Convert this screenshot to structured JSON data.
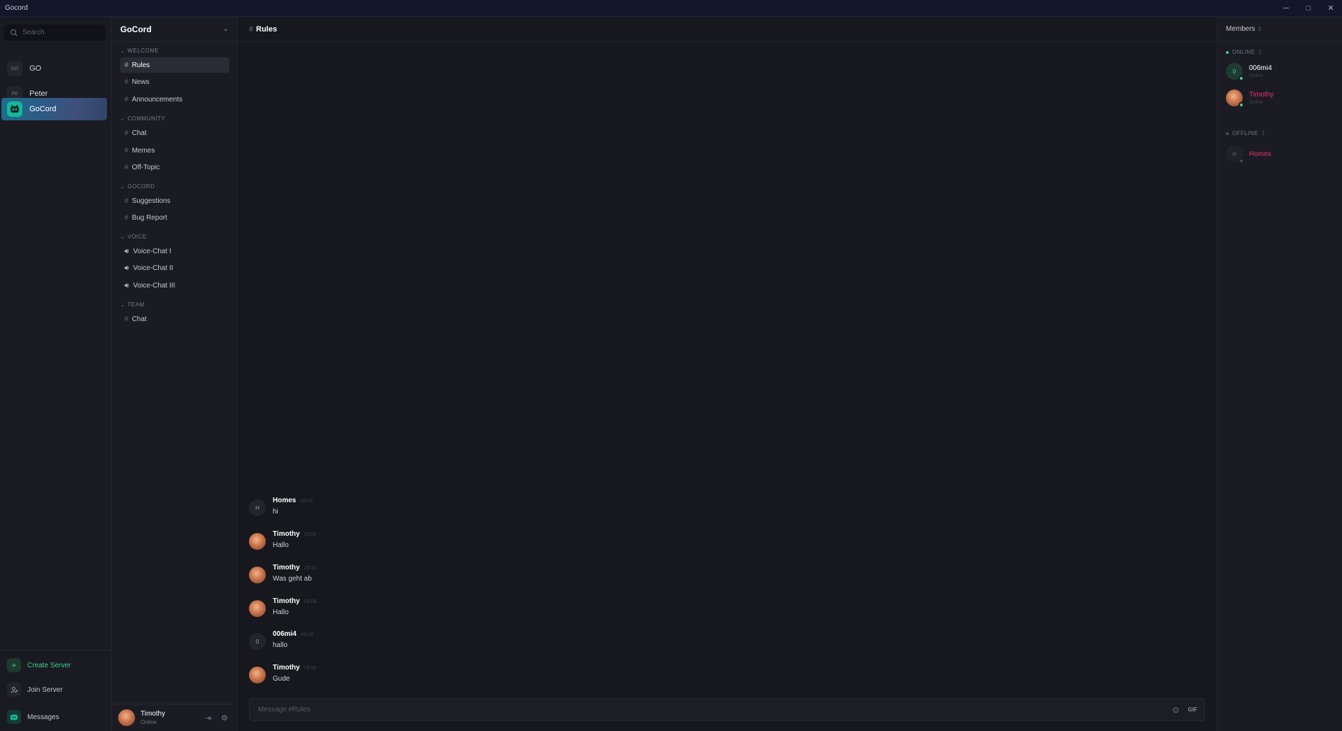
{
  "window": {
    "title": "Gocord",
    "min": "─",
    "max": "□",
    "close": "✕"
  },
  "search": {
    "placeholder": "Search"
  },
  "servers": [
    {
      "abbr": "GO",
      "name": "GO"
    },
    {
      "abbr": "PE",
      "name": "Peter"
    },
    {
      "abbr": "",
      "name": "GoCord"
    }
  ],
  "footer": {
    "create": "Create Server",
    "join": "Join Server",
    "messages": "Messages"
  },
  "server_header": {
    "title": "GoCord"
  },
  "categories": [
    {
      "name": "WELCOME",
      "channels": [
        "Rules",
        "News",
        "Announcements"
      ]
    },
    {
      "name": "COMMUNITY",
      "channels": [
        "Chat",
        "Memes",
        "Off-Topic"
      ]
    },
    {
      "name": "GOCORD",
      "channels": [
        "Suggestions",
        "Bug Report"
      ]
    },
    {
      "name": "VOICE",
      "channels": [
        "Voice-Chat I",
        "Voice-Chat II",
        "Voice-Chat III"
      ]
    },
    {
      "name": "TEAM",
      "channels": [
        "Chat"
      ]
    }
  ],
  "active_channel": "Rules",
  "user": {
    "name": "Timothy",
    "status": "Online"
  },
  "messages": [
    {
      "avatar": "H",
      "author": "Homes",
      "time": "20:03",
      "text": "hi"
    },
    {
      "avatar": "",
      "author": "Timothy",
      "time": "20:04",
      "text": "Hallo"
    },
    {
      "avatar": "",
      "author": "Timothy",
      "time": "23:15",
      "text": "Was geht ab"
    },
    {
      "avatar": "",
      "author": "Timothy",
      "time": "09:08",
      "text": "Hallo"
    },
    {
      "avatar": "0",
      "author": "006mi4",
      "time": "09:19",
      "text": "hallo"
    },
    {
      "avatar": "",
      "author": "Timothy",
      "time": "19:58",
      "text": "Gude"
    }
  ],
  "composer": {
    "placeholder": "Message #Rules",
    "gif": "GIF"
  },
  "members": {
    "title": "Members",
    "count": "3",
    "online_label": "ONLINE",
    "online_count": "2",
    "offline_label": "OFFLINE",
    "offline_count": "1",
    "online": [
      {
        "avatar": "0",
        "name": "006mi4",
        "status": "Online",
        "color": "#ffffff"
      },
      {
        "avatar": "",
        "name": "Timothy",
        "status": "Online",
        "color": "#e8316b"
      }
    ],
    "offline": [
      {
        "avatar": "H",
        "name": "Homes",
        "color": "#e8316b"
      }
    ]
  },
  "colors": {
    "accent": "#3ecf8e",
    "highlight": "#e8316b"
  }
}
